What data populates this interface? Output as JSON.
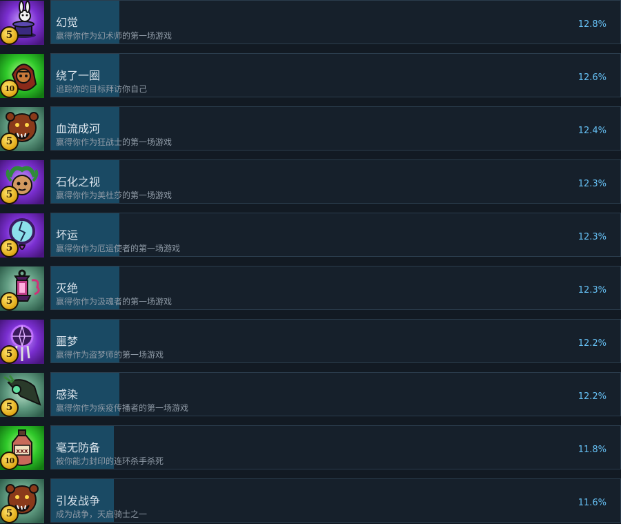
{
  "achievements": [
    {
      "title": "幻觉",
      "description": "赢得你作为幻术师的第一场游戏",
      "percent": "12.8%",
      "progress": 0.12,
      "points": "5",
      "icon": "magician-rabbit-hat-icon",
      "bg": "purple"
    },
    {
      "title": "绕了一圈",
      "description": "追踪你的目标拜访你自己",
      "percent": "12.6%",
      "progress": 0.12,
      "points": "10",
      "icon": "hooded-tracker-icon",
      "bg": "green"
    },
    {
      "title": "血流成河",
      "description": "赢得你作为狂战士的第一场游戏",
      "percent": "12.4%",
      "progress": 0.12,
      "points": "5",
      "icon": "berserker-bear-icon",
      "bg": "teal"
    },
    {
      "title": "石化之视",
      "description": "赢得你作为美杜莎的第一场游戏",
      "percent": "12.3%",
      "progress": 0.12,
      "points": "5",
      "icon": "medusa-icon",
      "bg": "purple"
    },
    {
      "title": "坏运",
      "description": "赢得你作为厄运使者的第一场游戏",
      "percent": "12.3%",
      "progress": 0.12,
      "points": "5",
      "icon": "cracked-mirror-icon",
      "bg": "purple"
    },
    {
      "title": "灭绝",
      "description": "赢得你作为汲魂者的第一场游戏",
      "percent": "12.3%",
      "progress": 0.12,
      "points": "5",
      "icon": "soul-lantern-icon",
      "bg": "teal"
    },
    {
      "title": "噩梦",
      "description": "赢得作为盗梦师的第一场游戏",
      "percent": "12.2%",
      "progress": 0.12,
      "points": "5",
      "icon": "dreamcatcher-icon",
      "bg": "purple"
    },
    {
      "title": "感染",
      "description": "赢得你作为疾疫传播者的第一场游戏",
      "percent": "12.2%",
      "progress": 0.12,
      "points": "5",
      "icon": "plague-doctor-mask-icon",
      "bg": "teal"
    },
    {
      "title": "毫无防备",
      "description": "被你能力封印的连环杀手杀死",
      "percent": "11.8%",
      "progress": 0.11,
      "points": "10",
      "icon": "poison-bottle-icon",
      "bg": "green"
    },
    {
      "title": "引发战争",
      "description": "成为战争，天启骑士之一",
      "percent": "11.6%",
      "progress": 0.11,
      "points": "5",
      "icon": "berserker-bear-icon",
      "bg": "teal"
    }
  ],
  "colors": {
    "accent": "#66c0f4",
    "progress_fill": "#1a4a64",
    "panel_bg": "#16202b",
    "page_bg": "#121a23"
  }
}
